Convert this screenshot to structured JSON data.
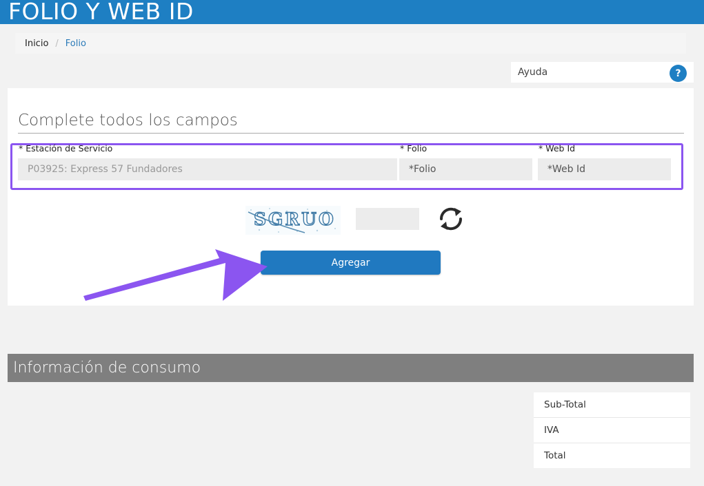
{
  "header": {
    "title": "FOLIO Y WEB ID"
  },
  "breadcrumb": {
    "home": "Inicio",
    "separator": "/",
    "current": "Folio"
  },
  "help": {
    "label": "Ayuda",
    "icon_char": "?"
  },
  "form": {
    "title": "Complete todos los campos",
    "fields": {
      "station": {
        "label": "* Estación de Servicio",
        "value": "P03925: Express 57 Fundadores"
      },
      "folio": {
        "label": "* Folio",
        "placeholder": "*Folio"
      },
      "webid": {
        "label": "* Web Id",
        "placeholder": "*Web Id"
      }
    },
    "captcha": {
      "text": "SGRUO",
      "icon": "refresh-icon"
    },
    "submit_label": "Agregar"
  },
  "consumption": {
    "title": "Información de consumo",
    "rows": [
      "Sub-Total",
      "IVA",
      "Total"
    ]
  },
  "colors": {
    "primary": "#1e7fc3",
    "highlight": "#8b55f0",
    "section_bar": "#7f7f7f"
  }
}
